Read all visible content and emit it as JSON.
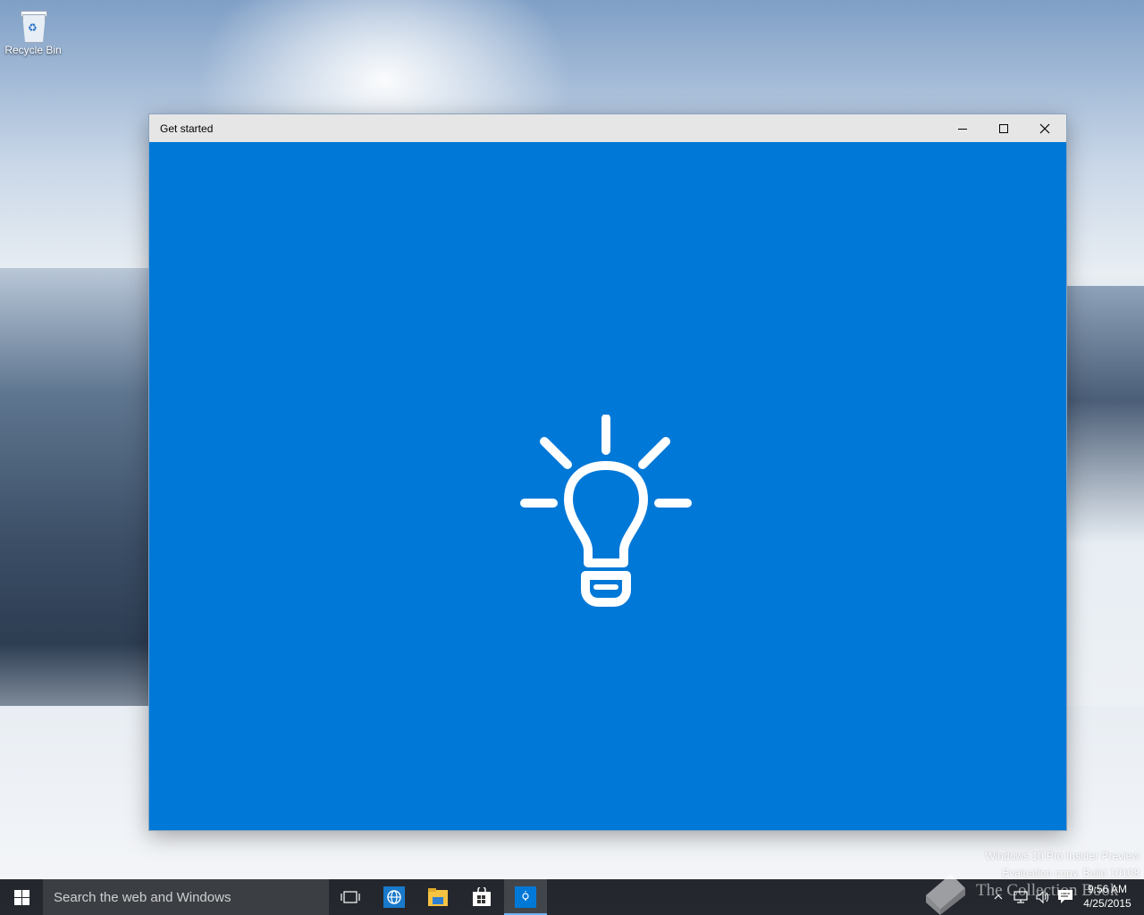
{
  "desktop": {
    "icons": [
      {
        "label": "Recycle Bin",
        "icon": "recycle-bin-icon"
      }
    ],
    "watermark": {
      "line1": "Windows 10 Pro Insider Preview",
      "line2": "Evaluation copy. Build 10108"
    },
    "overlay_text": "The Collection Book"
  },
  "window": {
    "title": "Get started",
    "accent_color": "#0078d7",
    "controls": [
      "minimize-icon",
      "maximize-icon",
      "close-icon"
    ],
    "center_icon": "lightbulb-icon"
  },
  "taskbar": {
    "search_placeholder": "Search the web and Windows",
    "apps": [
      "task-view-icon",
      "internet-explorer-icon",
      "file-explorer-icon",
      "store-icon",
      "get-started-icon"
    ],
    "active_app": "get-started-icon",
    "tray": {
      "icons": [
        "show-hidden-icons-chevron",
        "network-icon",
        "volume-icon",
        "action-center-icon"
      ],
      "time": "9:56 AM",
      "date": "4/25/2015"
    }
  }
}
